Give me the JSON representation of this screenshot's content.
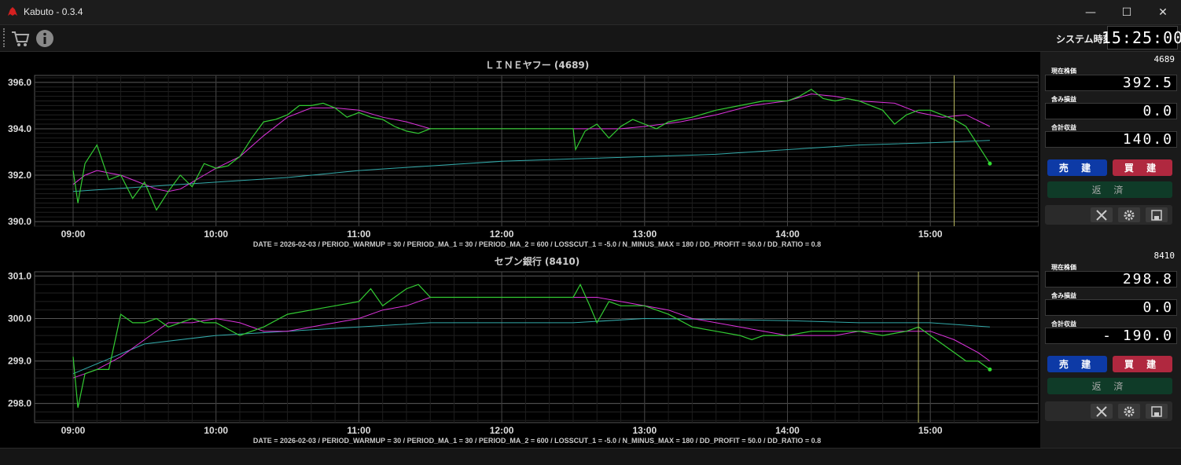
{
  "app": {
    "title": "Kabuto - 0.3.4"
  },
  "window_controls": {
    "minimize": "—",
    "maximize": "☐",
    "close": "✕"
  },
  "toolbar": {
    "icons": [
      "cart-icon",
      "info-icon"
    ],
    "system_time_label": "システム時刻",
    "system_time": "15:25:00"
  },
  "chart_data": [
    {
      "type": "line",
      "title": "ＬＩＮＥヤフー (4689)",
      "xlabel": "",
      "ylabel": "",
      "x_ticks": [
        "09:00",
        "10:00",
        "11:00",
        "12:00",
        "13:00",
        "14:00",
        "15:00"
      ],
      "y_ticks": [
        "390.0",
        "392.0",
        "394.0",
        "396.0"
      ],
      "ylim": [
        389.8,
        396.3
      ],
      "grid": true,
      "footer": "DATE = 2026-02-03 / PERIOD_WARMUP = 30 / PERIOD_MA_1 = 30 / PERIOD_MA_2 = 600 / LOSSCUT_1 = -5.0 / N_MINUS_MAX = 180 / DD_PROFIT = 50.0 / DD_RATIO = 0.8",
      "vline_time": "15:10",
      "series": [
        {
          "color": "#33cc33",
          "x": [
            "09:00",
            "09:02",
            "09:05",
            "09:10",
            "09:15",
            "09:20",
            "09:25",
            "09:30",
            "09:35",
            "09:40",
            "09:45",
            "09:50",
            "09:55",
            "10:00",
            "10:05",
            "10:10",
            "10:15",
            "10:20",
            "10:25",
            "10:30",
            "10:35",
            "10:40",
            "10:45",
            "10:50",
            "10:55",
            "11:00",
            "11:05",
            "11:10",
            "11:15",
            "11:20",
            "11:25",
            "11:30",
            "11:45",
            "12:00",
            "12:15",
            "12:30",
            "12:31",
            "12:35",
            "12:40",
            "12:45",
            "12:50",
            "12:55",
            "13:00",
            "13:05",
            "13:10",
            "13:20",
            "13:30",
            "13:40",
            "13:50",
            "14:00",
            "14:05",
            "14:10",
            "14:15",
            "14:20",
            "14:25",
            "14:30",
            "14:35",
            "14:40",
            "14:45",
            "14:50",
            "14:55",
            "15:00",
            "15:05",
            "15:10",
            "15:15",
            "15:20",
            "15:25"
          ],
          "y": [
            392.2,
            390.8,
            392.5,
            393.3,
            391.8,
            392.0,
            391.0,
            391.7,
            390.5,
            391.3,
            392.0,
            391.5,
            392.5,
            392.3,
            392.4,
            392.8,
            393.6,
            394.3,
            394.4,
            394.6,
            395.0,
            395.0,
            395.1,
            394.9,
            394.5,
            394.7,
            394.5,
            394.4,
            394.1,
            393.9,
            393.8,
            394.0,
            394.0,
            394.0,
            394.0,
            394.0,
            393.1,
            393.9,
            394.2,
            393.6,
            394.1,
            394.4,
            394.2,
            394.0,
            394.3,
            394.5,
            394.8,
            395.0,
            395.2,
            395.2,
            395.4,
            395.7,
            395.3,
            395.2,
            395.3,
            395.2,
            395.0,
            394.8,
            394.2,
            394.6,
            394.8,
            394.8,
            394.6,
            394.4,
            394.1,
            393.3,
            392.5
          ]
        },
        {
          "color": "#dd33dd",
          "x": [
            "09:00",
            "09:05",
            "09:10",
            "09:15",
            "09:20",
            "09:25",
            "09:30",
            "09:35",
            "09:40",
            "09:45",
            "09:50",
            "09:55",
            "10:00",
            "10:10",
            "10:20",
            "10:30",
            "10:40",
            "10:50",
            "11:00",
            "11:10",
            "11:20",
            "11:30",
            "11:45",
            "12:00",
            "12:30",
            "12:40",
            "12:50",
            "13:00",
            "13:15",
            "13:30",
            "13:45",
            "14:00",
            "14:10",
            "14:20",
            "14:30",
            "14:45",
            "14:55",
            "15:05",
            "15:15",
            "15:25"
          ],
          "y": [
            391.6,
            392.0,
            392.2,
            392.1,
            392.0,
            391.8,
            391.6,
            391.4,
            391.3,
            391.4,
            391.7,
            392.0,
            392.3,
            392.8,
            393.7,
            394.5,
            394.9,
            394.9,
            394.8,
            394.5,
            394.3,
            394.0,
            394.0,
            394.0,
            394.0,
            394.0,
            394.0,
            394.1,
            394.3,
            394.6,
            395.0,
            395.2,
            395.5,
            395.4,
            395.2,
            395.1,
            394.7,
            394.5,
            394.6,
            394.1
          ]
        },
        {
          "color": "#33aaaa",
          "x": [
            "09:00",
            "09:30",
            "10:00",
            "10:30",
            "11:00",
            "11:30",
            "12:00",
            "12:30",
            "13:00",
            "13:30",
            "14:00",
            "14:30",
            "15:00",
            "15:25"
          ],
          "y": [
            391.3,
            391.5,
            391.7,
            391.9,
            392.2,
            392.4,
            392.6,
            392.7,
            392.8,
            392.9,
            393.1,
            393.3,
            393.4,
            393.5
          ]
        }
      ]
    },
    {
      "type": "line",
      "title": "セブン銀行 (8410)",
      "xlabel": "",
      "ylabel": "",
      "x_ticks": [
        "09:00",
        "10:00",
        "11:00",
        "12:00",
        "13:00",
        "14:00",
        "15:00"
      ],
      "y_ticks": [
        "298.0",
        "299.0",
        "300.0",
        "301.0"
      ],
      "ylim": [
        297.55,
        301.1
      ],
      "grid": true,
      "footer": "DATE = 2026-02-03 / PERIOD_WARMUP = 30 / PERIOD_MA_1 = 30 / PERIOD_MA_2 = 600 / LOSSCUT_1 = -5.0 / N_MINUS_MAX = 180 / DD_PROFIT = 50.0 / DD_RATIO = 0.8",
      "vline_time": "14:55",
      "series": [
        {
          "color": "#33cc33",
          "x": [
            "09:00",
            "09:02",
            "09:05",
            "09:10",
            "09:15",
            "09:20",
            "09:25",
            "09:30",
            "09:35",
            "09:40",
            "09:45",
            "09:50",
            "09:55",
            "10:00",
            "10:10",
            "10:20",
            "10:30",
            "10:40",
            "10:50",
            "11:00",
            "11:05",
            "11:10",
            "11:20",
            "11:25",
            "11:30",
            "11:45",
            "12:00",
            "12:30",
            "12:33",
            "12:37",
            "12:40",
            "12:45",
            "12:50",
            "13:00",
            "13:10",
            "13:20",
            "13:30",
            "13:40",
            "13:45",
            "13:50",
            "14:00",
            "14:10",
            "14:20",
            "14:30",
            "14:40",
            "14:50",
            "14:55",
            "15:00",
            "15:05",
            "15:10",
            "15:15",
            "15:20",
            "15:25"
          ],
          "y": [
            299.1,
            297.9,
            298.7,
            298.8,
            298.8,
            300.1,
            299.9,
            299.9,
            300.0,
            299.8,
            299.9,
            300.0,
            299.9,
            299.9,
            299.6,
            299.8,
            300.1,
            300.2,
            300.3,
            300.4,
            300.7,
            300.3,
            300.7,
            300.8,
            300.5,
            300.5,
            300.5,
            300.5,
            300.8,
            300.3,
            299.9,
            300.4,
            300.3,
            300.3,
            300.1,
            299.8,
            299.7,
            299.6,
            299.5,
            299.6,
            299.6,
            299.7,
            299.7,
            299.7,
            299.6,
            299.7,
            299.8,
            299.6,
            299.4,
            299.2,
            299.0,
            299.0,
            298.8
          ]
        },
        {
          "color": "#dd33dd",
          "x": [
            "09:00",
            "09:05",
            "09:10",
            "09:20",
            "09:30",
            "09:40",
            "09:50",
            "10:00",
            "10:10",
            "10:20",
            "10:30",
            "10:40",
            "10:50",
            "11:00",
            "11:10",
            "11:20",
            "11:30",
            "11:45",
            "12:00",
            "12:30",
            "12:40",
            "12:50",
            "13:00",
            "13:10",
            "13:20",
            "13:30",
            "13:40",
            "13:50",
            "14:00",
            "14:10",
            "14:20",
            "14:30",
            "14:40",
            "14:50",
            "15:00",
            "15:10",
            "15:20",
            "15:25"
          ],
          "y": [
            298.6,
            298.7,
            298.8,
            299.1,
            299.5,
            299.9,
            299.9,
            300.0,
            299.9,
            299.7,
            299.7,
            299.8,
            299.9,
            300.0,
            300.2,
            300.3,
            300.5,
            300.5,
            300.5,
            300.5,
            300.5,
            300.4,
            300.3,
            300.2,
            300.0,
            299.9,
            299.8,
            299.7,
            299.6,
            299.6,
            299.6,
            299.7,
            299.7,
            299.7,
            299.7,
            299.5,
            299.2,
            299.0
          ]
        },
        {
          "color": "#33aaaa",
          "x": [
            "09:00",
            "09:30",
            "10:00",
            "10:30",
            "11:00",
            "11:30",
            "12:00",
            "12:30",
            "13:00",
            "13:30",
            "14:00",
            "14:30",
            "15:00",
            "15:25"
          ],
          "y": [
            298.7,
            299.4,
            299.6,
            299.7,
            299.8,
            299.9,
            299.9,
            299.9,
            300.0,
            299.98,
            299.95,
            299.9,
            299.9,
            299.8
          ]
        }
      ]
    }
  ],
  "panels": [
    {
      "code": "4689",
      "price_label": "現在株価",
      "price": "392.5",
      "unrealized_label": "含み損益",
      "unrealized": "0.0",
      "total_label": "合計収益",
      "total": "140.0",
      "sell_label": "売 建",
      "buy_label": "買 建",
      "close_label": "返 済"
    },
    {
      "code": "8410",
      "price_label": "現在株価",
      "price": "298.8",
      "unrealized_label": "含み損益",
      "unrealized": "0.0",
      "total_label": "合計収益",
      "total": "- 190.0",
      "sell_label": "売 建",
      "buy_label": "買 建",
      "close_label": "返 済"
    }
  ]
}
